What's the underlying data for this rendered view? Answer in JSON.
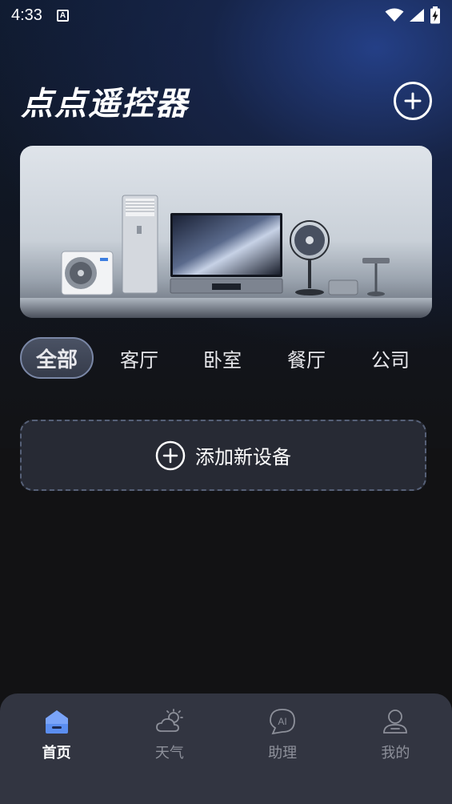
{
  "status_bar": {
    "time": "4:33",
    "notification_icon_letter": "A",
    "icons": [
      "wifi-icon",
      "signal-icon",
      "battery-charging-icon"
    ]
  },
  "header": {
    "title": "点点遥控器",
    "add_icon": "plus-circle-icon"
  },
  "banner": {
    "image": "home-appliances-banner"
  },
  "room_tabs": [
    {
      "label": "全部",
      "active": true
    },
    {
      "label": "客厅",
      "active": false
    },
    {
      "label": "卧室",
      "active": false
    },
    {
      "label": "餐厅",
      "active": false
    },
    {
      "label": "公司",
      "active": false
    }
  ],
  "add_device": {
    "label": "添加新设备",
    "icon": "plus-circle-icon"
  },
  "bottom_nav": [
    {
      "label": "首页",
      "icon": "home-icon",
      "active": true
    },
    {
      "label": "天气",
      "icon": "weather-icon",
      "active": false
    },
    {
      "label": "助理",
      "icon": "ai-assistant-icon",
      "active": false
    },
    {
      "label": "我的",
      "icon": "profile-icon",
      "active": false
    }
  ],
  "colors": {
    "background": "#121214",
    "accent_blue": "#4a78e0",
    "nav_background": "#323541",
    "inactive_text": "#8d909a"
  }
}
